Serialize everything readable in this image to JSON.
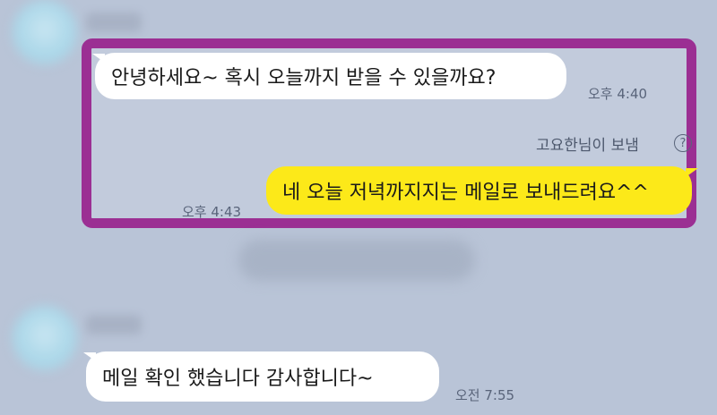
{
  "messages": [
    {
      "text": "안녕하세요~ 혹시 오늘까지 받을 수 있을까요?",
      "time": "오후 4:40",
      "direction": "incoming"
    },
    {
      "sender_label": "고요한님이 보냄",
      "text": "네 오늘 저녁까지지는 메일로 보내드려요^^",
      "time": "오후 4:43",
      "direction": "outgoing"
    },
    {
      "text": "메일 확인 했습니다 감사합니다~",
      "time": "오전 7:55",
      "direction": "incoming"
    }
  ],
  "icons": {
    "help": "?"
  },
  "colors": {
    "background": "#b9c4d7",
    "incoming_bubble": "#ffffff",
    "outgoing_bubble": "#fce919",
    "highlight_border": "#9b2f93"
  }
}
